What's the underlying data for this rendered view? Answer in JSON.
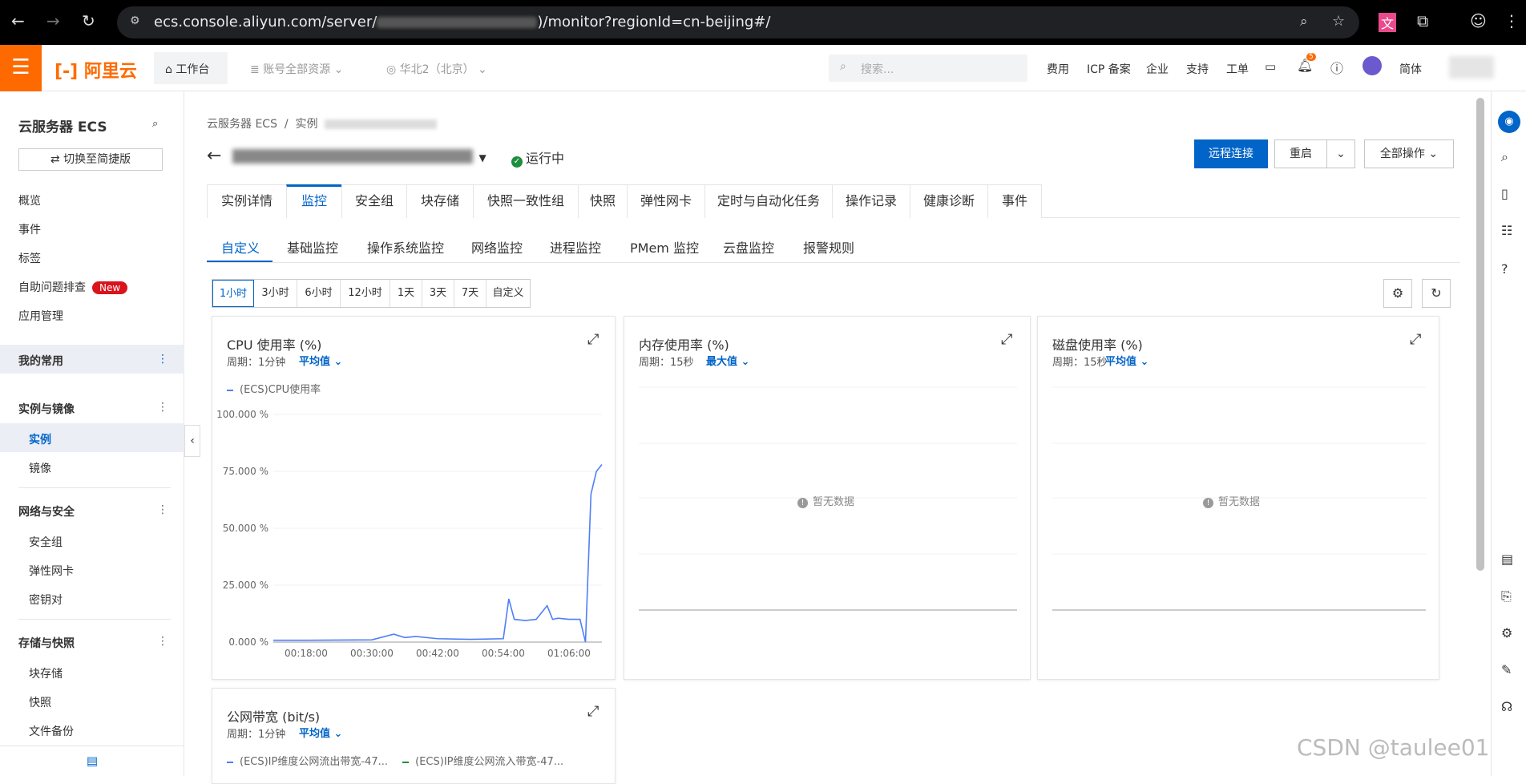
{
  "browser": {
    "url_prefix": "ecs.console.aliyun.com/server/",
    "url_suffix": ")/monitor?regionId=cn-beijing#/"
  },
  "topbar": {
    "logo": "阿里云",
    "workbench": "工作台",
    "account": "账号全部资源",
    "region": "华北2（北京）",
    "search_placeholder": "搜索...",
    "links": [
      "费用",
      "ICP 备案",
      "企业",
      "支持",
      "工单"
    ],
    "notif_count": "5",
    "lang": "简体"
  },
  "sidebar": {
    "title": "云服务器 ECS",
    "switch": "切换至简捷版",
    "items": [
      "概览",
      "事件",
      "标签",
      "自助问题排查",
      "应用管理"
    ],
    "new_badge": "New",
    "groups": {
      "fav": "我的常用",
      "instances": "实例与镜像",
      "net": "网络与安全",
      "storage": "存储与快照"
    },
    "instances_items": [
      "实例",
      "镜像"
    ],
    "net_items": [
      "安全组",
      "弹性网卡",
      "密钥对"
    ],
    "storage_items": [
      "块存储",
      "快照",
      "文件备份"
    ]
  },
  "main": {
    "crumb1": "云服务器 ECS",
    "crumb2": "实例",
    "status": "运行中",
    "btn_remote": "远程连接",
    "btn_restart": "重启",
    "btn_all": "全部操作",
    "tabs": [
      "实例详情",
      "监控",
      "安全组",
      "块存储",
      "快照一致性组",
      "快照",
      "弹性网卡",
      "定时与自动化任务",
      "操作记录",
      "健康诊断",
      "事件"
    ],
    "subtabs": [
      "自定义",
      "基础监控",
      "操作系统监控",
      "网络监控",
      "进程监控",
      "PMem 监控",
      "云盘监控",
      "报警规则"
    ],
    "time_ranges": [
      "1小时",
      "3小时",
      "6小时",
      "12小时",
      "1天",
      "3天",
      "7天",
      "自定义"
    ]
  },
  "cards": {
    "cpu": {
      "title": "CPU 使用率 (%)",
      "period": "周期：1分钟",
      "agg": "平均值",
      "legend": "(ECS)CPU使用率"
    },
    "mem": {
      "title": "内存使用率 (%)",
      "period": "周期：15秒",
      "agg": "最大值",
      "nodata": "暂无数据"
    },
    "disk": {
      "title": "磁盘使用率 (%)",
      "period": "周期：15秒",
      "agg": "平均值",
      "nodata": "暂无数据"
    },
    "bw": {
      "title": "公网带宽 (bit/s)",
      "period": "周期：1分钟",
      "agg": "平均值",
      "legend_out": "(ECS)IP维度公网流出带宽-47...",
      "legend_in": "(ECS)IP维度公网流入带宽-47..."
    }
  },
  "watermark": "CSDN @taulee01",
  "colors": {
    "brand": "#ff6a00",
    "primary": "#0064c8",
    "line": "#4f7ef7",
    "line_in": "#1e8e3e"
  },
  "chart_data": {
    "type": "line",
    "title": "CPU 使用率 (%)",
    "series": [
      {
        "name": "(ECS)CPU使用率",
        "x": [
          "00:12",
          "00:18",
          "00:24",
          "00:30",
          "00:34",
          "00:36",
          "00:38",
          "00:42",
          "00:48",
          "00:54",
          "00:55",
          "00:56",
          "00:58",
          "01:00",
          "01:02",
          "01:03",
          "01:04",
          "01:06",
          "01:08",
          "01:09",
          "01:10",
          "01:11",
          "01:12"
        ],
        "values": [
          0.8,
          0.8,
          0.9,
          1.0,
          3.5,
          2.0,
          2.5,
          1.5,
          1.2,
          1.5,
          19,
          10,
          9.5,
          10,
          16,
          10,
          10.5,
          10,
          10,
          0,
          65,
          75,
          78
        ]
      }
    ],
    "yticks": [
      "100.000 %",
      "75.000 %",
      "50.000 %",
      "25.000 %",
      "0.000 %"
    ],
    "xticks": [
      "00:18:00",
      "00:30:00",
      "00:42:00",
      "00:54:00",
      "01:06:00"
    ],
    "ylim": [
      0,
      100
    ]
  }
}
